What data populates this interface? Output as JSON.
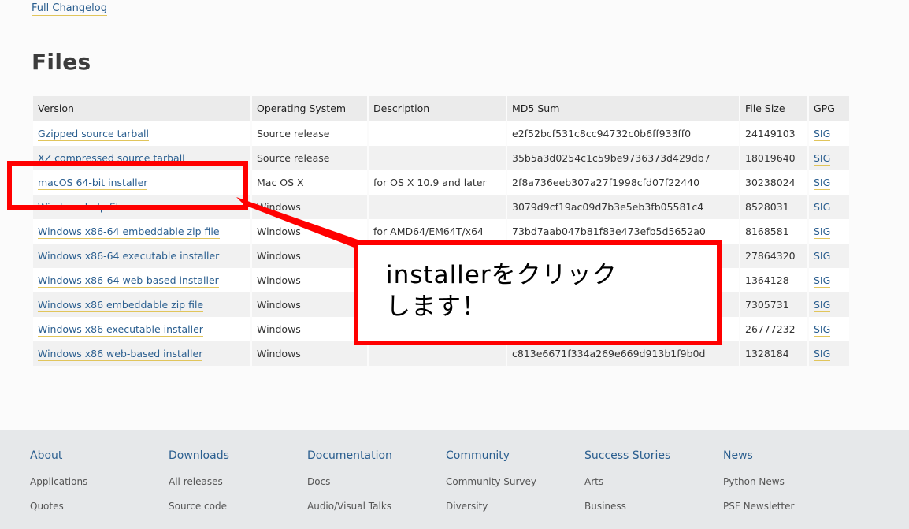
{
  "changelog_link": "Full Changelog",
  "files_heading": "Files",
  "table": {
    "headers": [
      "Version",
      "Operating System",
      "Description",
      "MD5 Sum",
      "File Size",
      "GPG"
    ],
    "rows": [
      {
        "version": "Gzipped source tarball",
        "os": "Source release",
        "description": "",
        "md5": "e2f52bcf531c8cc94732c0b6ff933ff0",
        "size": "24149103",
        "gpg": "SIG"
      },
      {
        "version": "XZ compressed source tarball",
        "os": "Source release",
        "description": "",
        "md5": "35b5a3d0254c1c59be9736373d429db7",
        "size": "18019640",
        "gpg": "SIG"
      },
      {
        "version": "macOS 64-bit installer",
        "os": "Mac OS X",
        "description": "for OS X 10.9 and later",
        "md5": "2f8a736eeb307a27f1998cfd07f22440",
        "size": "30238024",
        "gpg": "SIG"
      },
      {
        "version": "Windows help file",
        "os": "Windows",
        "description": "",
        "md5": "3079d9cf19ac09d7b3e5eb3fb05581c4",
        "size": "8528031",
        "gpg": "SIG"
      },
      {
        "version": "Windows x86-64 embeddable zip file",
        "os": "Windows",
        "description": "for AMD64/EM64T/x64",
        "md5": "73bd7aab047b81f83e473efb5d5652a0",
        "size": "8168581",
        "gpg": "SIG"
      },
      {
        "version": "Windows x86-64 executable installer",
        "os": "Windows",
        "description": "",
        "md5": "",
        "size": "27864320",
        "gpg": "SIG"
      },
      {
        "version": "Windows x86-64 web-based installer",
        "os": "Windows",
        "description": "",
        "md5": "",
        "size": "1364128",
        "gpg": "SIG"
      },
      {
        "version": "Windows x86 embeddable zip file",
        "os": "Windows",
        "description": "",
        "md5": "",
        "size": "7305731",
        "gpg": "SIG"
      },
      {
        "version": "Windows x86 executable installer",
        "os": "Windows",
        "description": "",
        "md5": "",
        "size": "26777232",
        "gpg": "SIG"
      },
      {
        "version": "Windows x86 web-based installer",
        "os": "Windows",
        "description": "",
        "md5": "c813e6671f334a269e669d913b1f9b0d",
        "size": "1328184",
        "gpg": "SIG"
      }
    ]
  },
  "callout": {
    "line1": "installerをクリック",
    "line2": "します！",
    "color": "#ff0000"
  },
  "footer": {
    "columns": [
      {
        "heading": "About",
        "links": [
          "Applications",
          "Quotes"
        ]
      },
      {
        "heading": "Downloads",
        "links": [
          "All releases",
          "Source code"
        ]
      },
      {
        "heading": "Documentation",
        "links": [
          "Docs",
          "Audio/Visual Talks"
        ]
      },
      {
        "heading": "Community",
        "links": [
          "Community Survey",
          "Diversity"
        ]
      },
      {
        "heading": "Success Stories",
        "links": [
          "Arts",
          "Business"
        ]
      },
      {
        "heading": "News",
        "links": [
          "Python News",
          "PSF Newsletter"
        ]
      }
    ]
  }
}
